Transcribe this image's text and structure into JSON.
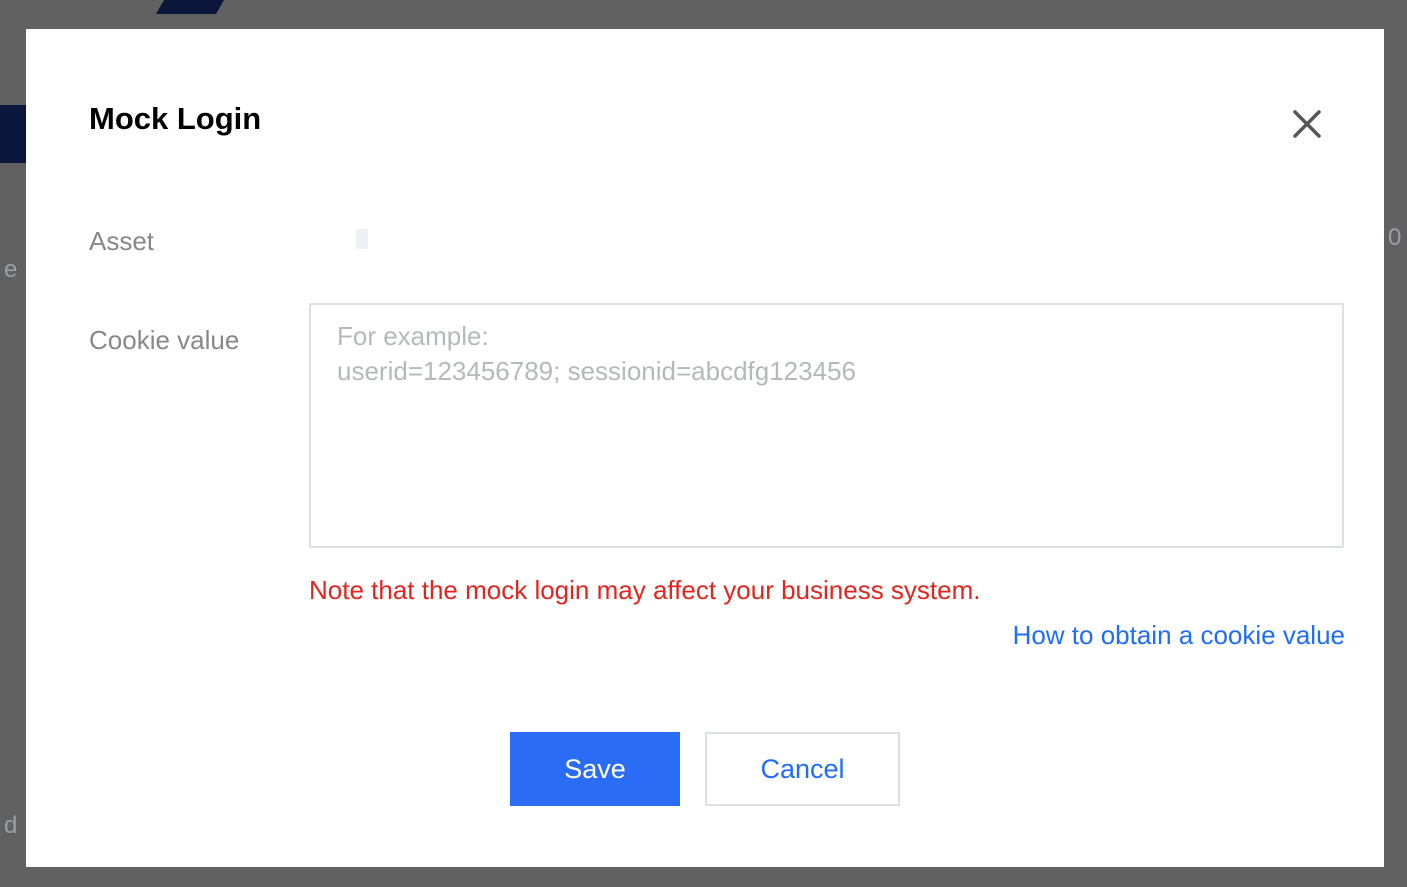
{
  "background": {
    "left_fragment_1": "e",
    "left_fragment_2": "d",
    "right_fragment": "0"
  },
  "dialog": {
    "title": "Mock Login",
    "close_icon": "close-icon",
    "form": {
      "asset_label": "Asset",
      "asset_value": "",
      "cookie_label": "Cookie value",
      "cookie_value": "",
      "cookie_placeholder": "For example:\nuserid=123456789; sessionid=abcdfg123456"
    },
    "warning": "Note that the mock login may affect your business system.",
    "help_link": "How to obtain a cookie value",
    "save_label": "Save",
    "cancel_label": "Cancel"
  },
  "colors": {
    "primary": "#2a6df4",
    "link": "#1f6ef5",
    "warning": "#e3251f",
    "label": "#888888"
  }
}
